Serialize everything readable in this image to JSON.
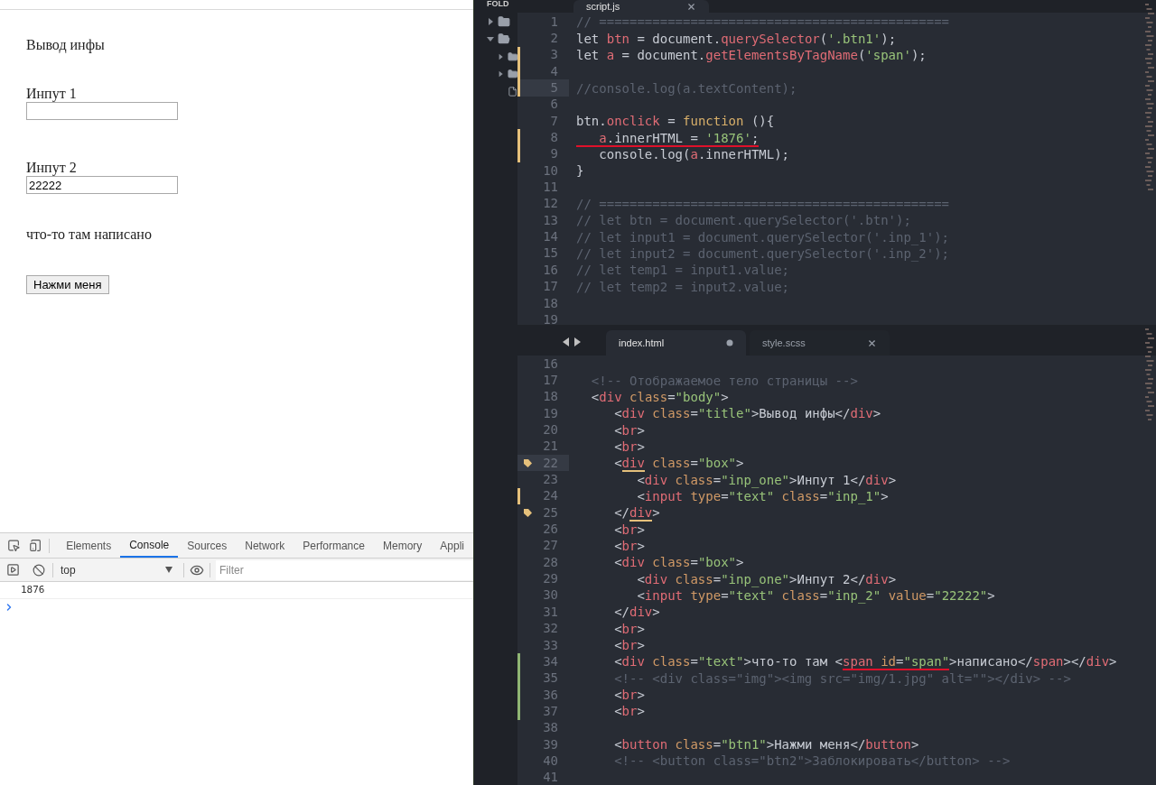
{
  "browser_page": {
    "title": "Вывод инфы",
    "boxes": [
      {
        "label": "Инпут 1"
      },
      {
        "label": "Инпут 2",
        "value": "22222"
      }
    ],
    "text": "что-то там написано",
    "button": "Нажми меня"
  },
  "devtools": {
    "tabs": [
      {
        "label": "Elements",
        "selected": false
      },
      {
        "label": "Console",
        "selected": true
      },
      {
        "label": "Sources",
        "selected": false
      },
      {
        "label": "Network",
        "selected": false
      },
      {
        "label": "Performance",
        "selected": false
      },
      {
        "label": "Memory",
        "selected": false
      },
      {
        "label": "Appli",
        "selected": false
      }
    ],
    "context": "top",
    "filter": {
      "placeholder": "Filter"
    },
    "messages": [
      "1876"
    ]
  },
  "sidebar": {
    "header": "FOLD",
    "items": [
      {
        "kind": "folder",
        "expanded": false
      },
      {
        "kind": "folder",
        "expanded": true,
        "children": [
          {
            "kind": "folder",
            "expanded": false
          },
          {
            "kind": "folder",
            "expanded": false
          },
          {
            "kind": "file"
          }
        ]
      }
    ]
  },
  "top_pane": {
    "tabs": [
      {
        "label": "script.js",
        "selected": true,
        "modified": false
      }
    ],
    "lines": [
      {
        "num": "1",
        "tokens": [
          {
            "text": "// ==============================================",
            "kind": "cm"
          }
        ]
      },
      {
        "num": "2",
        "tokens": [
          {
            "text": "let ",
            "kind": "kw"
          },
          {
            "text": "btn",
            "kind": "var"
          },
          {
            "text": " = document.",
            "kind": "p"
          },
          {
            "text": "querySelector",
            "kind": "fn"
          },
          {
            "text": "(",
            "kind": "p"
          },
          {
            "text": "'.btn1'",
            "kind": "str"
          },
          {
            "text": ");",
            "kind": "p"
          }
        ]
      },
      {
        "num": "3",
        "modified": true,
        "tokens": [
          {
            "text": "let ",
            "kind": "kw"
          },
          {
            "text": "a",
            "kind": "var"
          },
          {
            "text": " = document.",
            "kind": "p"
          },
          {
            "text": "getElementsByTagName",
            "kind": "fn"
          },
          {
            "text": "(",
            "kind": "p"
          },
          {
            "text": "'span'",
            "kind": "str"
          },
          {
            "text": ");",
            "kind": "p"
          }
        ]
      },
      {
        "num": "4",
        "modified": true
      },
      {
        "num": "5",
        "modified": true,
        "current": true,
        "tokens": [
          {
            "text": "//console.log(a.textContent);",
            "kind": "cm"
          }
        ]
      },
      {
        "num": "6"
      },
      {
        "num": "7",
        "tokens": [
          {
            "text": "btn.",
            "kind": "p"
          },
          {
            "text": "onclick",
            "kind": "fn"
          },
          {
            "text": " = ",
            "kind": "p"
          },
          {
            "text": "function",
            "kind": "kw2"
          },
          {
            "text": " (){",
            "kind": "p"
          }
        ]
      },
      {
        "num": "8",
        "modified": true,
        "tokens": [
          {
            "text": "   a",
            "kind": "var",
            "error": true
          },
          {
            "text": ".innerHTML = ",
            "kind": "p",
            "error": true
          },
          {
            "text": "'1876'",
            "kind": "str",
            "error": true
          },
          {
            "text": ";",
            "kind": "p",
            "error": true
          }
        ]
      },
      {
        "num": "9",
        "modified": true,
        "tokens": [
          {
            "text": "   console.log(",
            "kind": "p"
          },
          {
            "text": "a",
            "kind": "var"
          },
          {
            "text": ".innerHTML);",
            "kind": "p"
          }
        ]
      },
      {
        "num": "10",
        "tokens": [
          {
            "text": "}",
            "kind": "p"
          }
        ]
      },
      {
        "num": "11"
      },
      {
        "num": "12",
        "tokens": [
          {
            "text": "// ==============================================",
            "kind": "cm"
          }
        ]
      },
      {
        "num": "13",
        "tokens": [
          {
            "text": "// let btn = document.querySelector('.btn');",
            "kind": "cm"
          }
        ]
      },
      {
        "num": "14",
        "tokens": [
          {
            "text": "// let input1 = document.querySelector('.inp_1');",
            "kind": "cm"
          }
        ]
      },
      {
        "num": "15",
        "tokens": [
          {
            "text": "// let input2 = document.querySelector('.inp_2');",
            "kind": "cm"
          }
        ]
      },
      {
        "num": "16",
        "tokens": [
          {
            "text": "// let temp1 = input1.value;",
            "kind": "cm"
          }
        ]
      },
      {
        "num": "17",
        "tokens": [
          {
            "text": "// let temp2 = input2.value;",
            "kind": "cm"
          }
        ]
      },
      {
        "num": "18"
      },
      {
        "num": "19"
      }
    ]
  },
  "bottom_pane": {
    "tabs": [
      {
        "label": "index.html",
        "selected": true,
        "modified": true
      },
      {
        "label": "style.scss",
        "selected": false,
        "modified": false
      }
    ],
    "lines": [
      {
        "num": "16"
      },
      {
        "num": "17",
        "tokens": [
          {
            "text": "  <!-- Отображаемое тело страницы -->",
            "kind": "cm"
          }
        ]
      },
      {
        "num": "18",
        "tokens": [
          {
            "text": "  <",
            "kind": "p"
          },
          {
            "text": "div",
            "kind": "tag"
          },
          {
            "text": " class",
            "kind": "attr"
          },
          {
            "text": "=",
            "kind": "p"
          },
          {
            "text": "\"body\"",
            "kind": "str"
          },
          {
            "text": ">",
            "kind": "p"
          }
        ]
      },
      {
        "num": "19",
        "tokens": [
          {
            "text": "     <",
            "kind": "p"
          },
          {
            "text": "div",
            "kind": "tag"
          },
          {
            "text": " class",
            "kind": "attr"
          },
          {
            "text": "=",
            "kind": "p"
          },
          {
            "text": "\"title\"",
            "kind": "str"
          },
          {
            "text": ">Вывод инфы</",
            "kind": "p"
          },
          {
            "text": "div",
            "kind": "tag"
          },
          {
            "text": ">",
            "kind": "p"
          }
        ]
      },
      {
        "num": "20",
        "tokens": [
          {
            "text": "     <",
            "kind": "p"
          },
          {
            "text": "br",
            "kind": "tag"
          },
          {
            "text": ">",
            "kind": "p"
          }
        ]
      },
      {
        "num": "21",
        "tokens": [
          {
            "text": "     <",
            "kind": "p"
          },
          {
            "text": "br",
            "kind": "tag"
          },
          {
            "text": ">",
            "kind": "p"
          }
        ]
      },
      {
        "num": "22",
        "bookmark": true,
        "current": true,
        "tokens": [
          {
            "text": "     <",
            "kind": "p"
          },
          {
            "text": "div",
            "kind": "tag",
            "match": true
          },
          {
            "text": " class",
            "kind": "attr"
          },
          {
            "text": "=",
            "kind": "p"
          },
          {
            "text": "\"box\"",
            "kind": "str"
          },
          {
            "text": ">",
            "kind": "p"
          }
        ]
      },
      {
        "num": "23",
        "tokens": [
          {
            "text": "        <",
            "kind": "p"
          },
          {
            "text": "div",
            "kind": "tag"
          },
          {
            "text": " class",
            "kind": "attr"
          },
          {
            "text": "=",
            "kind": "p"
          },
          {
            "text": "\"inp_one\"",
            "kind": "str"
          },
          {
            "text": ">Инпут 1</",
            "kind": "p"
          },
          {
            "text": "div",
            "kind": "tag"
          },
          {
            "text": ">",
            "kind": "p"
          }
        ]
      },
      {
        "num": "24",
        "modified": true,
        "tokens": [
          {
            "text": "        <",
            "kind": "p"
          },
          {
            "text": "input",
            "kind": "tag"
          },
          {
            "text": " type",
            "kind": "attr"
          },
          {
            "text": "=",
            "kind": "p"
          },
          {
            "text": "\"text\"",
            "kind": "str"
          },
          {
            "text": " class",
            "kind": "attr"
          },
          {
            "text": "=",
            "kind": "p"
          },
          {
            "text": "\"inp_1\"",
            "kind": "str"
          },
          {
            "text": ">",
            "kind": "p"
          }
        ]
      },
      {
        "num": "25",
        "bookmark": true,
        "tokens": [
          {
            "text": "     </",
            "kind": "p"
          },
          {
            "text": "div",
            "kind": "tag",
            "match": true
          },
          {
            "text": ">",
            "kind": "p"
          }
        ]
      },
      {
        "num": "26",
        "tokens": [
          {
            "text": "     <",
            "kind": "p"
          },
          {
            "text": "br",
            "kind": "tag"
          },
          {
            "text": ">",
            "kind": "p"
          }
        ]
      },
      {
        "num": "27",
        "tokens": [
          {
            "text": "     <",
            "kind": "p"
          },
          {
            "text": "br",
            "kind": "tag"
          },
          {
            "text": ">",
            "kind": "p"
          }
        ]
      },
      {
        "num": "28",
        "tokens": [
          {
            "text": "     <",
            "kind": "p"
          },
          {
            "text": "div",
            "kind": "tag"
          },
          {
            "text": " class",
            "kind": "attr"
          },
          {
            "text": "=",
            "kind": "p"
          },
          {
            "text": "\"box\"",
            "kind": "str"
          },
          {
            "text": ">",
            "kind": "p"
          }
        ]
      },
      {
        "num": "29",
        "tokens": [
          {
            "text": "        <",
            "kind": "p"
          },
          {
            "text": "div",
            "kind": "tag"
          },
          {
            "text": " class",
            "kind": "attr"
          },
          {
            "text": "=",
            "kind": "p"
          },
          {
            "text": "\"inp_one\"",
            "kind": "str"
          },
          {
            "text": ">Инпут 2</",
            "kind": "p"
          },
          {
            "text": "div",
            "kind": "tag"
          },
          {
            "text": ">",
            "kind": "p"
          }
        ]
      },
      {
        "num": "30",
        "tokens": [
          {
            "text": "        <",
            "kind": "p"
          },
          {
            "text": "input",
            "kind": "tag"
          },
          {
            "text": " type",
            "kind": "attr"
          },
          {
            "text": "=",
            "kind": "p"
          },
          {
            "text": "\"text\"",
            "kind": "str"
          },
          {
            "text": " class",
            "kind": "attr"
          },
          {
            "text": "=",
            "kind": "p"
          },
          {
            "text": "\"inp_2\"",
            "kind": "str"
          },
          {
            "text": " value",
            "kind": "attr"
          },
          {
            "text": "=",
            "kind": "p"
          },
          {
            "text": "\"22222\"",
            "kind": "str"
          },
          {
            "text": ">",
            "kind": "p"
          }
        ]
      },
      {
        "num": "31",
        "tokens": [
          {
            "text": "     </",
            "kind": "p"
          },
          {
            "text": "div",
            "kind": "tag"
          },
          {
            "text": ">",
            "kind": "p"
          }
        ]
      },
      {
        "num": "32",
        "tokens": [
          {
            "text": "     <",
            "kind": "p"
          },
          {
            "text": "br",
            "kind": "tag"
          },
          {
            "text": ">",
            "kind": "p"
          }
        ]
      },
      {
        "num": "33",
        "tokens": [
          {
            "text": "     <",
            "kind": "p"
          },
          {
            "text": "br",
            "kind": "tag"
          },
          {
            "text": ">",
            "kind": "p"
          }
        ]
      },
      {
        "num": "34",
        "added": true,
        "tokens": [
          {
            "text": "     <",
            "kind": "p"
          },
          {
            "text": "div",
            "kind": "tag"
          },
          {
            "text": " class",
            "kind": "attr"
          },
          {
            "text": "=",
            "kind": "p"
          },
          {
            "text": "\"text\"",
            "kind": "str"
          },
          {
            "text": ">что-то там <",
            "kind": "p"
          },
          {
            "text": "span",
            "kind": "tag",
            "error": true
          },
          {
            "text": " id",
            "kind": "attr",
            "error": true
          },
          {
            "text": "=",
            "kind": "p",
            "error": true
          },
          {
            "text": "\"span\"",
            "kind": "str",
            "error": true
          },
          {
            "text": ">написано</",
            "kind": "p"
          },
          {
            "text": "span",
            "kind": "tag"
          },
          {
            "text": "></",
            "kind": "p"
          },
          {
            "text": "div",
            "kind": "tag"
          },
          {
            "text": ">",
            "kind": "p"
          }
        ]
      },
      {
        "num": "35",
        "added": true,
        "tokens": [
          {
            "text": "     <!-- <div class=\"img\"><img src=\"img/1.jpg\" alt=\"\"></div> -->",
            "kind": "cm"
          }
        ]
      },
      {
        "num": "36",
        "added": true,
        "tokens": [
          {
            "text": "     <",
            "kind": "p"
          },
          {
            "text": "br",
            "kind": "tag"
          },
          {
            "text": ">",
            "kind": "p"
          }
        ]
      },
      {
        "num": "37",
        "added": true,
        "tokens": [
          {
            "text": "     <",
            "kind": "p"
          },
          {
            "text": "br",
            "kind": "tag"
          },
          {
            "text": ">",
            "kind": "p"
          }
        ]
      },
      {
        "num": "38"
      },
      {
        "num": "39",
        "tokens": [
          {
            "text": "     <",
            "kind": "p"
          },
          {
            "text": "button",
            "kind": "tag"
          },
          {
            "text": " class",
            "kind": "attr"
          },
          {
            "text": "=",
            "kind": "p"
          },
          {
            "text": "\"btn1\"",
            "kind": "str"
          },
          {
            "text": ">Нажми меня</",
            "kind": "p"
          },
          {
            "text": "button",
            "kind": "tag"
          },
          {
            "text": ">",
            "kind": "p"
          }
        ]
      },
      {
        "num": "40",
        "tokens": [
          {
            "text": "     <!-- <button class=\"btn2\">Заблокировать</button> -->",
            "kind": "cm"
          }
        ]
      },
      {
        "num": "41"
      }
    ]
  }
}
